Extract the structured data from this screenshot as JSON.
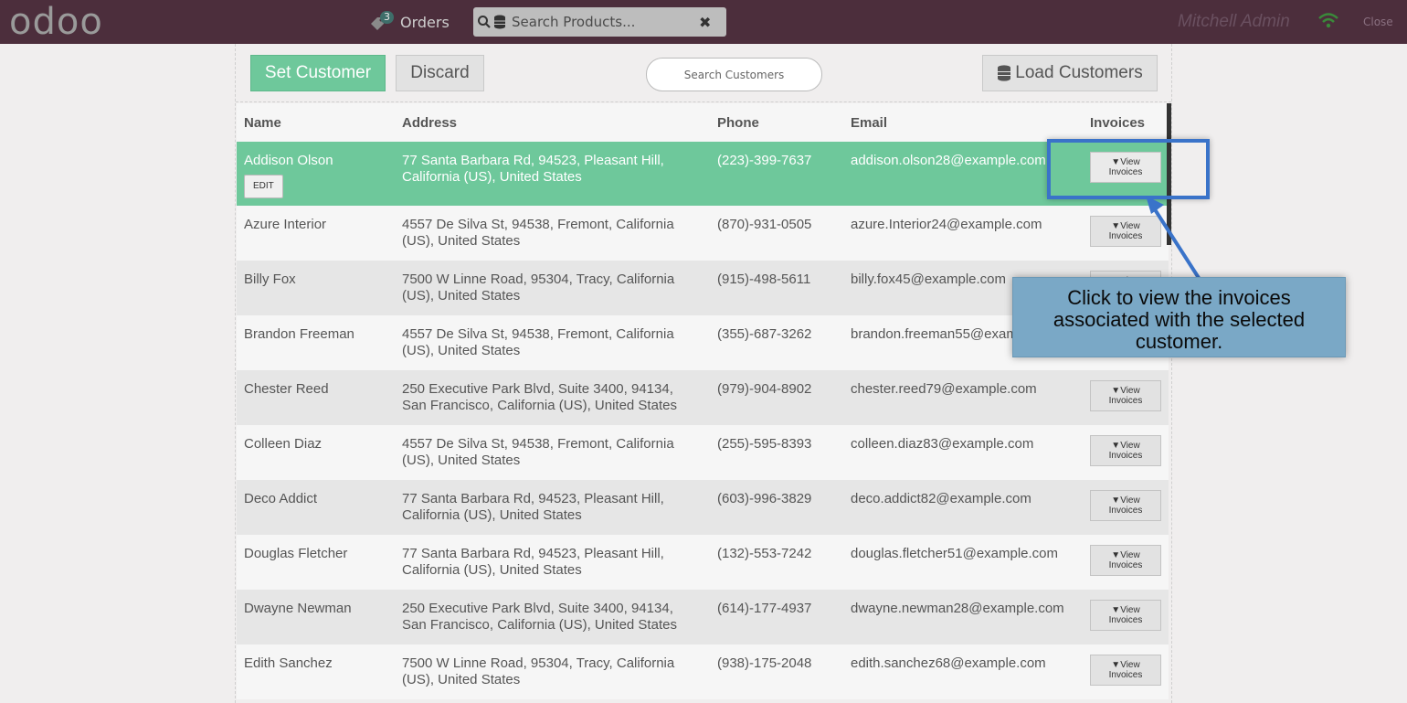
{
  "topbar": {
    "logo": "odoo",
    "orders_label": "Orders",
    "orders_count": "3",
    "product_search_placeholder": "Search Products...",
    "user": "Mitchell Admin",
    "close_label": "Close"
  },
  "actions": {
    "set_customer": "Set Customer",
    "discard": "Discard",
    "search_customers_placeholder": "Search Customers",
    "load_customers": "Load Customers"
  },
  "table": {
    "headers": [
      "Name",
      "Address",
      "Phone",
      "Email",
      "Invoices"
    ],
    "edit_label": "EDIT",
    "view_invoices_line1": "View",
    "view_invoices_line2": "Invoices",
    "rows": [
      {
        "name": "Addison Olson",
        "addr1": "77 Santa Barbara Rd, 94523, Pleasant Hill,",
        "addr2": "California (US), United States",
        "phone": "(223)-399-7637",
        "email": "addison.olson28@example.com"
      },
      {
        "name": "Azure Interior",
        "addr1": "4557 De Silva St, 94538, Fremont, California",
        "addr2": "(US), United States",
        "phone": "(870)-931-0505",
        "email": "azure.Interior24@example.com"
      },
      {
        "name": "Billy Fox",
        "addr1": "7500 W Linne Road, 95304, Tracy, California",
        "addr2": "(US), United States",
        "phone": "(915)-498-5611",
        "email": "billy.fox45@example.com"
      },
      {
        "name": "Brandon Freeman",
        "addr1": "4557 De Silva St, 94538, Fremont, California",
        "addr2": "(US), United States",
        "phone": "(355)-687-3262",
        "email": "brandon.freeman55@example.com"
      },
      {
        "name": "Chester Reed",
        "addr1": "250 Executive Park Blvd, Suite 3400, 94134,",
        "addr2": "San Francisco, California (US), United States",
        "phone": "(979)-904-8902",
        "email": "chester.reed79@example.com"
      },
      {
        "name": "Colleen Diaz",
        "addr1": "4557 De Silva St, 94538, Fremont, California",
        "addr2": "(US), United States",
        "phone": "(255)-595-8393",
        "email": "colleen.diaz83@example.com"
      },
      {
        "name": "Deco Addict",
        "addr1": "77 Santa Barbara Rd, 94523, Pleasant Hill,",
        "addr2": "California (US), United States",
        "phone": "(603)-996-3829",
        "email": "deco.addict82@example.com"
      },
      {
        "name": "Douglas Fletcher",
        "addr1": "77 Santa Barbara Rd, 94523, Pleasant Hill,",
        "addr2": "California (US), United States",
        "phone": "(132)-553-7242",
        "email": "douglas.fletcher51@example.com"
      },
      {
        "name": "Dwayne Newman",
        "addr1": "250 Executive Park Blvd, Suite 3400, 94134,",
        "addr2": "San Francisco, California (US), United States",
        "phone": "(614)-177-4937",
        "email": "dwayne.newman28@example.com"
      },
      {
        "name": "Edith Sanchez",
        "addr1": "7500 W Linne Road, 95304, Tracy, California",
        "addr2": "(US), United States",
        "phone": "(938)-175-2048",
        "email": "edith.sanchez68@example.com"
      }
    ]
  },
  "tooltip": {
    "text": "Click to view the invoices associated with the selected customer."
  },
  "colors": {
    "topbar": "#4c2e3c",
    "accent_green": "#6ec89b",
    "highlight_blue": "#3a73c9",
    "tooltip_bg": "#7aa8c6"
  }
}
